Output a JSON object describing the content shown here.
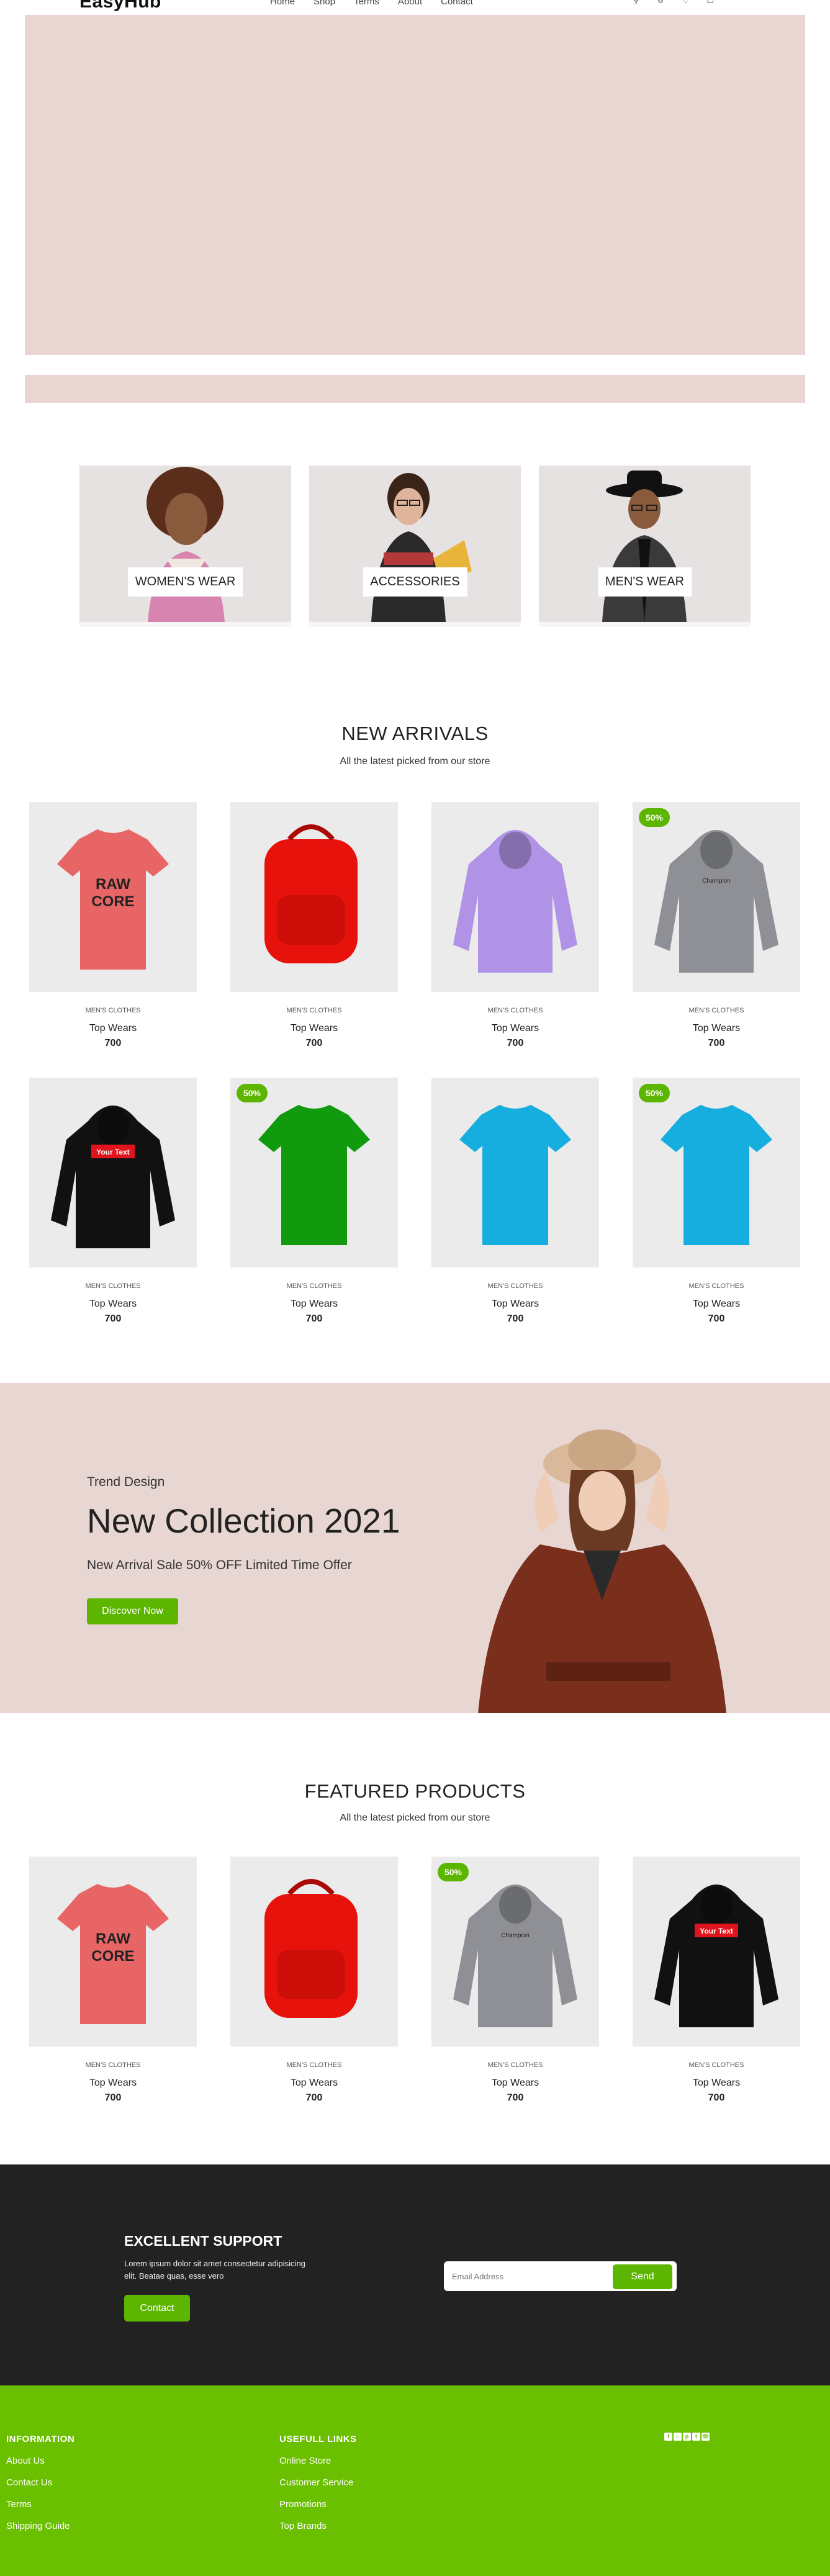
{
  "header": {
    "logo": "EasyHub",
    "nav": [
      "Home",
      "Shop",
      "Terms",
      "About",
      "Contact"
    ],
    "icons": [
      "search-icon",
      "user-icon",
      "heart-icon",
      "cart-icon"
    ]
  },
  "categories": [
    {
      "label": "WOMEN'S WEAR"
    },
    {
      "label": "ACCESSORIES"
    },
    {
      "label": "MEN'S WEAR"
    }
  ],
  "new_arrivals": {
    "title": "NEW ARRIVALS",
    "subtitle": "All the latest picked from our store",
    "products": [
      {
        "category": "MEN'S CLOTHES",
        "name": "Top Wears",
        "price": "700",
        "badge": "",
        "image": "pink-tshirt",
        "print": "RAW CORE"
      },
      {
        "category": "MEN'S CLOTHES",
        "name": "Top Wears",
        "price": "700",
        "badge": "",
        "image": "red-backpack",
        "print": ""
      },
      {
        "category": "MEN'S CLOTHES",
        "name": "Top Wears",
        "price": "700",
        "badge": "",
        "image": "lilac-hoodie",
        "print": ""
      },
      {
        "category": "MEN'S CLOTHES",
        "name": "Top Wears",
        "price": "700",
        "badge": "50%",
        "image": "grey-hoodie",
        "print": ""
      },
      {
        "category": "MEN'S CLOTHES",
        "name": "Top Wears",
        "price": "700",
        "badge": "",
        "image": "black-hoodie",
        "print": "Your Text"
      },
      {
        "category": "MEN'S CLOTHES",
        "name": "Top Wears",
        "price": "700",
        "badge": "50%",
        "image": "green-tshirt",
        "print": ""
      },
      {
        "category": "MEN'S CLOTHES",
        "name": "Top Wears",
        "price": "700",
        "badge": "",
        "image": "blue-tshirt",
        "print": ""
      },
      {
        "category": "MEN'S CLOTHES",
        "name": "Top Wears",
        "price": "700",
        "badge": "50%",
        "image": "blue-tshirt",
        "print": ""
      }
    ]
  },
  "promo": {
    "small": "Trend Design",
    "title": "New Collection 2021",
    "offer": "New Arrival Sale 50% OFF Limited Time Offer",
    "button": "Discover Now"
  },
  "featured": {
    "title": "FEATURED PRODUCTS",
    "subtitle": "All the latest picked from our store",
    "products": [
      {
        "category": "MEN'S CLOTHES",
        "name": "Top Wears",
        "price": "700",
        "badge": "",
        "image": "pink-tshirt",
        "print": "RAW CORE"
      },
      {
        "category": "MEN'S CLOTHES",
        "name": "Top Wears",
        "price": "700",
        "badge": "",
        "image": "red-backpack",
        "print": ""
      },
      {
        "category": "MEN'S CLOTHES",
        "name": "Top Wears",
        "price": "700",
        "badge": "50%",
        "image": "grey-hoodie",
        "print": ""
      },
      {
        "category": "MEN'S CLOTHES",
        "name": "Top Wears",
        "price": "700",
        "badge": "",
        "image": "black-hoodie",
        "print": "Your Text"
      }
    ]
  },
  "support": {
    "title": "EXCELLENT SUPPORT",
    "text": "Lorem ipsum dolor sit amet consectetur adipisicing elit. Beatae quas, esse vero",
    "contact_button": "Contact",
    "email_placeholder": "Email Address",
    "send_button": "Send"
  },
  "footer": {
    "information": {
      "title": "INFORMATION",
      "links": [
        "About Us",
        "Contact Us",
        "Terms",
        "Shipping Guide"
      ]
    },
    "useful": {
      "title": "USEFULL LINKS",
      "links": [
        "Online Store",
        "Customer Service",
        "Promotions",
        "Top Brands"
      ]
    },
    "socials": [
      "facebook-icon",
      "instagram-icon",
      "pinterest-icon",
      "twitter-icon",
      "whatsapp-icon"
    ]
  },
  "colors": {
    "accent": "#5cb600",
    "footer": "#6abf00",
    "hero": "#e8d6d3",
    "dark": "#222222"
  }
}
